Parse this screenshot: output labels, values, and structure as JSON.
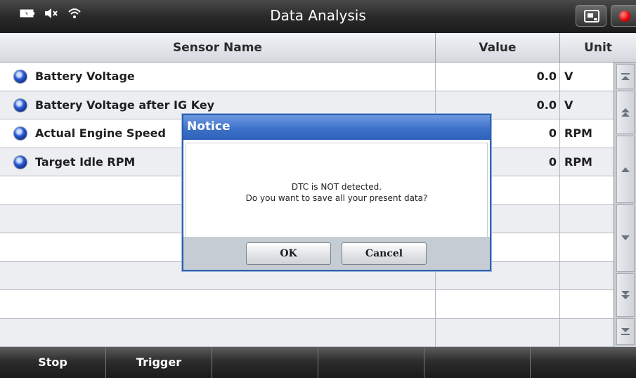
{
  "window": {
    "title": "Data Analysis",
    "status_icons": [
      "battery-icon",
      "speaker-muted-icon",
      "wifi-icon"
    ],
    "toolbar_buttons": [
      "screen-capture-icon",
      "record-icon"
    ]
  },
  "table": {
    "headers": {
      "name": "Sensor Name",
      "value": "Value",
      "unit": "Unit"
    },
    "rows": [
      {
        "name": "Battery Voltage",
        "value": "0.0",
        "unit": "V"
      },
      {
        "name": "Battery Voltage after IG Key",
        "value": "0.0",
        "unit": "V"
      },
      {
        "name": "Actual Engine Speed",
        "value": "0",
        "unit": "RPM"
      },
      {
        "name": "Target Idle RPM",
        "value": "0",
        "unit": "RPM"
      },
      {
        "name": "",
        "value": "",
        "unit": ""
      },
      {
        "name": "",
        "value": "",
        "unit": ""
      },
      {
        "name": "",
        "value": "",
        "unit": ""
      },
      {
        "name": "",
        "value": "",
        "unit": ""
      },
      {
        "name": "",
        "value": "",
        "unit": ""
      },
      {
        "name": "",
        "value": "",
        "unit": ""
      }
    ]
  },
  "scrollbar": {
    "buttons": [
      "scroll-top-icon",
      "page-up-icon",
      "up-icon",
      "down-icon",
      "page-down-icon",
      "scroll-bottom-icon"
    ]
  },
  "footer": {
    "buttons": [
      "Stop",
      "Trigger",
      "",
      "",
      "",
      ""
    ]
  },
  "dialog": {
    "title": "Notice",
    "message_line1": "DTC is NOT detected.",
    "message_line2": "Do you want to save all your present data?",
    "ok_label": "OK",
    "cancel_label": "Cancel"
  },
  "colors": {
    "titlebar": "#2a2a2a",
    "dialog_title": "#3d72c9",
    "record": "#e00000",
    "row_bullet": "#2a5bd7"
  }
}
